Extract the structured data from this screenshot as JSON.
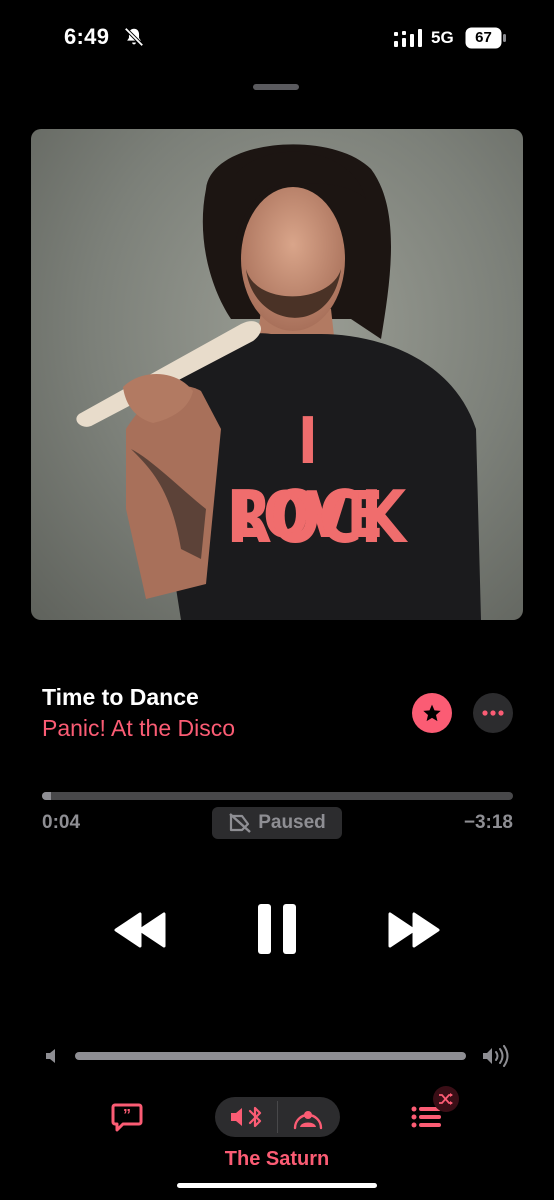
{
  "status_bar": {
    "time": "6:49",
    "network": "5G",
    "battery": "67",
    "icons": [
      "bell-slash-icon",
      "signal-bars-icon",
      "battery-icon"
    ]
  },
  "artwork": {
    "shirt_line1": "I LOVE",
    "shirt_line2": "ROCK"
  },
  "now_playing": {
    "title": "Time to Dance",
    "artist": "Panic! At the Disco",
    "favorited": true
  },
  "playback": {
    "elapsed": "0:04",
    "remaining": "−3:18",
    "state_label": "Paused",
    "progress": 0.02,
    "volume": 1.0
  },
  "output": {
    "device_name": "The Saturn"
  },
  "colors": {
    "accent": "#fb5c74",
    "secondary_text": "#8e8e93",
    "background": "#000000",
    "pill": "#2c2c2e"
  }
}
